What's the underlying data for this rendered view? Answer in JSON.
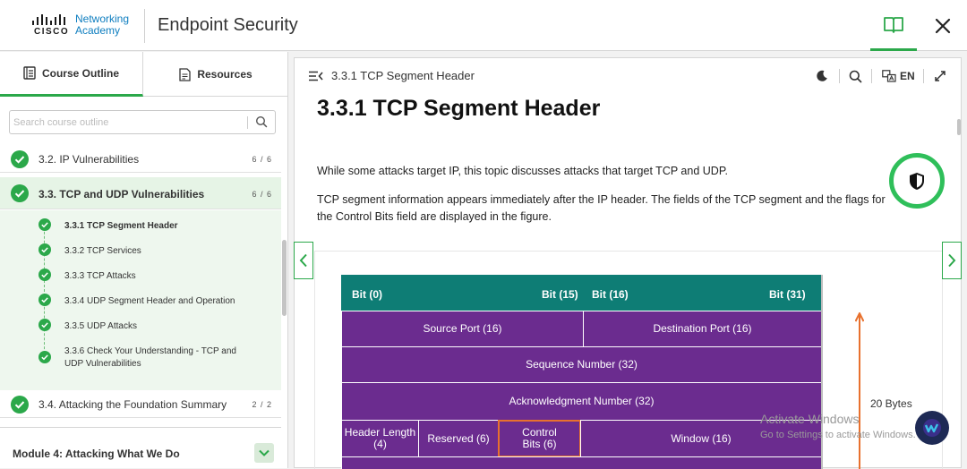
{
  "header": {
    "logo_brand": "CISCO",
    "logo_line1": "Networking",
    "logo_line2": "Academy",
    "title": "Endpoint Security",
    "book_icon": "book-icon",
    "close_icon": "close-icon"
  },
  "left_panel": {
    "tabs": [
      {
        "label": "Course Outline",
        "icon": "outline-icon",
        "active": true
      },
      {
        "label": "Resources",
        "icon": "document-icon",
        "active": false
      }
    ],
    "search_placeholder": "Search course outline",
    "sections": [
      {
        "title": "3.2. IP Vulnerabilities",
        "count": "6 / 6"
      },
      {
        "title": "3.3. TCP and UDP Vulnerabilities",
        "count": "6 / 6"
      },
      {
        "title": "3.4. Attacking the Foundation Summary",
        "count": "2 / 2"
      }
    ],
    "subitems": [
      {
        "title": "3.3.1 TCP Segment Header"
      },
      {
        "title": "3.3.2 TCP Services"
      },
      {
        "title": "3.3.3 TCP Attacks"
      },
      {
        "title": "3.3.4 UDP Segment Header and Operation"
      },
      {
        "title": "3.3.5 UDP Attacks"
      },
      {
        "title_line1": "3.3.6 Check Your Understanding - TCP and",
        "title_line2": "UDP Vulnerabilities"
      }
    ],
    "module_title": "Module 4: Attacking What We Do"
  },
  "content": {
    "toolbar_title": "3.3.1 TCP Segment Header",
    "language": "EN",
    "heading": "3.3.1 TCP Segment Header",
    "para1": "While some attacks target IP, this topic discusses attacks that target TCP and UDP.",
    "para2_line1": "TCP segment information appears immediately after the IP header. The fields of the TCP segment and the flags for",
    "para2_line2": "the Control Bits field are displayed in the figure."
  },
  "figure": {
    "bit0": "Bit (0)",
    "bit15": "Bit (15)",
    "bit16": "Bit (16)",
    "bit31": "Bit (31)",
    "source_port": "Source Port (16)",
    "destination_port": "Destination Port (16)",
    "sequence_number": "Sequence Number (32)",
    "ack_number": "Acknowledgment Number (32)",
    "header_length_1": "Header Length",
    "header_length_2": "(4)",
    "reserved": "Reserved (6)",
    "control_bits_1": "Control",
    "control_bits_2": "Bits (6)",
    "window": "Window (16)",
    "bytes_label": "20 Bytes"
  },
  "watermark": {
    "line1": "Activate Windows",
    "line2": "Go to Settings to activate Windows."
  },
  "colors": {
    "accent_green": "#2ba84a",
    "header_teal": "#0e7d75",
    "field_purple": "#6b2c8f",
    "control_orange": "#e8712e"
  }
}
